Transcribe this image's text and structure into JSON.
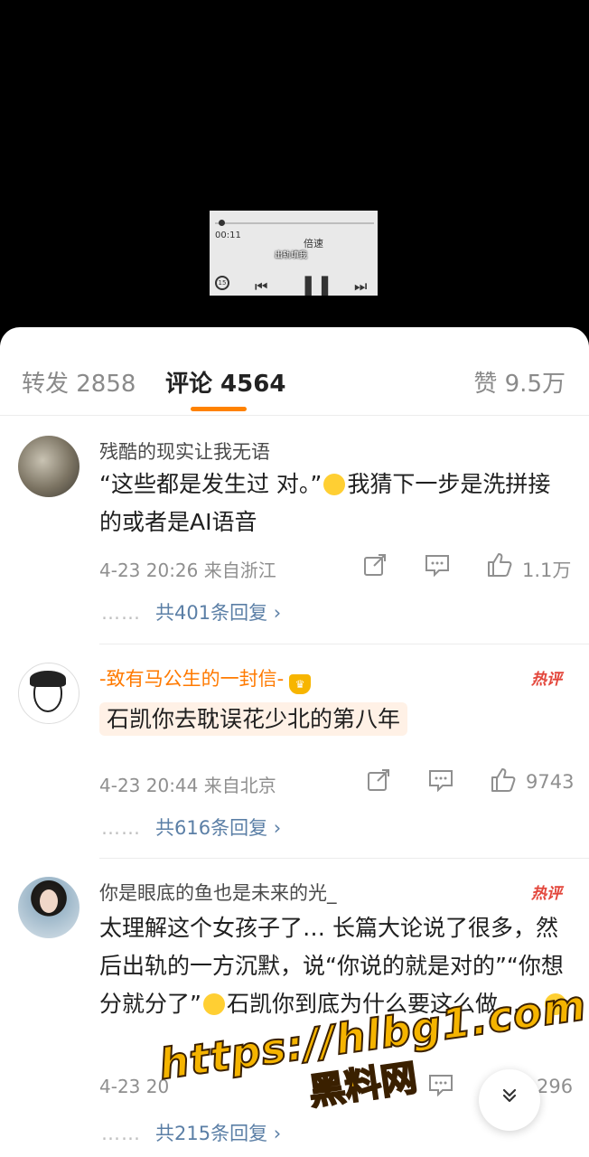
{
  "video": {
    "time": "00:11",
    "speed_label": "倍速",
    "caption": "出轨填我",
    "replay_label": "15"
  },
  "tabs": {
    "repost": "转发 2858",
    "comment": "评论 4564",
    "like": "赞 9.5万"
  },
  "comments": [
    {
      "username": "残酷的现实让我无语",
      "text_part1": "“这些都是发生过 对。”",
      "text_part2": "我猜下一步是洗拼接的或者是AI语音",
      "meta": "4-23 20:26  来自浙江",
      "likes": "1.1万",
      "replies": "共401条回复 ›"
    },
    {
      "username": "-致有马公生的一封信-",
      "hot": "热评",
      "text": "石凯你去耽误花少北的第八年",
      "meta": "4-23 20:44  来自北京",
      "likes": "9743",
      "replies": "共616条回复 ›"
    },
    {
      "username": "你是眼底的鱼也是未来的光_",
      "hot": "热评",
      "text_part1": "太理解这个女孩子了… 长篇大论说了很多，然后出轨的一方沉默，说“你说的就是对的”“你想分就分了”",
      "text_part2": "石凯你到底为什么要这么做……",
      "meta": "4-23 20",
      "likes": "296",
      "replies": "共215条回复 ›"
    }
  ],
  "watermark": {
    "url": "https://hlbg1.com",
    "name": "黑料网"
  },
  "reply_dots": "……",
  "scroll_icon": "chevron-double-down-icon"
}
